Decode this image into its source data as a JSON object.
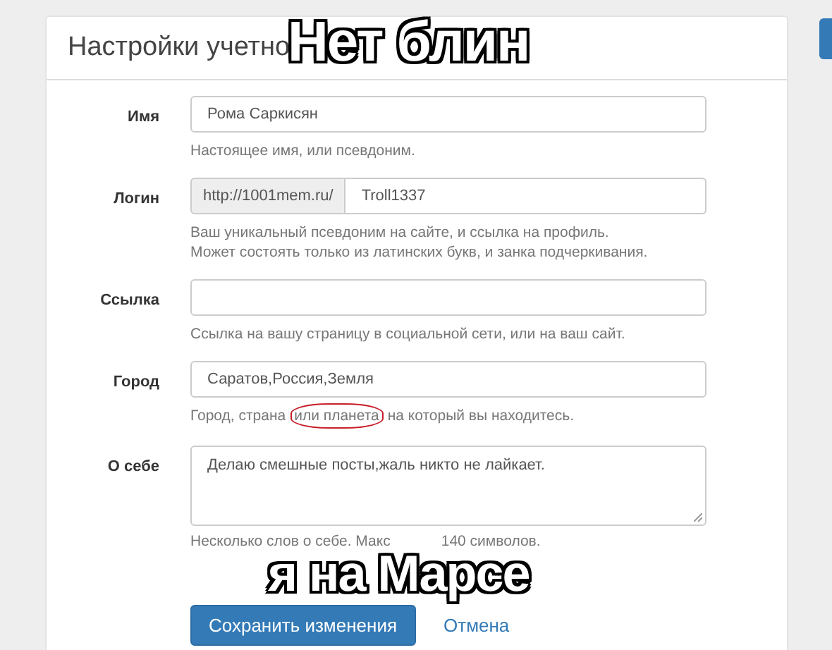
{
  "panel": {
    "title": "Настройки учетно"
  },
  "captions": [
    {
      "text": "Нет блин"
    },
    {
      "text": "я на Марсе"
    }
  ],
  "fields": [
    {
      "kind": "text",
      "label": "Имя",
      "value": "Рома Саркисян",
      "hint": [
        [
          {
            "text": "Настоящее имя, или псевдоним."
          }
        ]
      ]
    },
    {
      "kind": "prefixed",
      "label": "Логин",
      "prefix": "http://1001mem.ru/",
      "value": "Troll1337",
      "hint": [
        [
          {
            "text": "Ваш уникальный псевдоним на сайте, и ссылка на профиль."
          }
        ],
        [
          {
            "text": "Может состоять только из латинских букв, и занка подчеркивания."
          }
        ]
      ]
    },
    {
      "kind": "text",
      "label": "Ссылка",
      "hint": [
        [
          {
            "text": "Ссылка на вашу страницу в социальной сети, или на ваш сайт."
          }
        ]
      ]
    },
    {
      "kind": "text",
      "label": "Город",
      "value": "Саратов,Россия,Земля",
      "hint": [
        [
          {
            "text": "Город, страна",
            "circled": false
          },
          {
            "text": "или планета",
            "circled": true
          },
          {
            "text": "на который вы находитесь.",
            "circled": false
          }
        ]
      ]
    },
    {
      "kind": "textarea",
      "label": "О себе",
      "value": "Делаю смешные посты,жаль никто не лайкает.",
      "hint": [
        [
          {
            "text": "Несколько слов о себе. Макс"
          },
          {
            "text": "140 символов."
          }
        ]
      ]
    }
  ],
  "actions": [
    {
      "kind": "primary",
      "label": "Сохранить изменения"
    },
    {
      "kind": "link",
      "label": "Отмена"
    }
  ]
}
